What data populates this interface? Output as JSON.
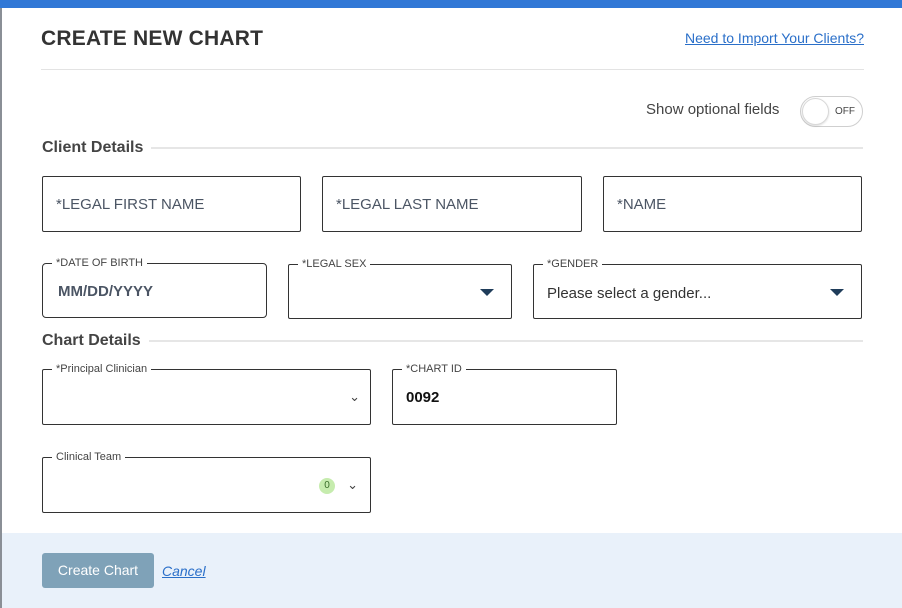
{
  "header": {
    "title": "CREATE NEW CHART",
    "import_link": "Need to Import Your Clients?"
  },
  "optional_fields": {
    "label": "Show optional fields",
    "toggle_state": "OFF"
  },
  "client_details": {
    "title": "Client Details",
    "legal_first_name": {
      "placeholder": "*LEGAL FIRST NAME"
    },
    "legal_last_name": {
      "placeholder": "*LEGAL LAST NAME"
    },
    "name": {
      "placeholder": "*NAME"
    },
    "date_of_birth": {
      "label": "*DATE OF BIRTH",
      "placeholder": "MM/DD/YYYY"
    },
    "legal_sex": {
      "label": "*LEGAL SEX",
      "value": ""
    },
    "gender": {
      "label": "*GENDER",
      "value": "Please select a gender..."
    }
  },
  "chart_details": {
    "title": "Chart Details",
    "principal_clinician": {
      "label": "*Principal Clinician",
      "value": ""
    },
    "chart_id": {
      "label": "*CHART ID",
      "value": "0092"
    },
    "clinical_team": {
      "label": "Clinical Team",
      "count": "0"
    }
  },
  "footer": {
    "create_label": "Create Chart",
    "cancel_label": "Cancel"
  },
  "colors": {
    "accent": "#3178d6",
    "link": "#2a6fc9",
    "button_disabled": "#7fa2b8",
    "footer_bg": "#e9f1fa",
    "badge_bg": "#c6ecae"
  }
}
